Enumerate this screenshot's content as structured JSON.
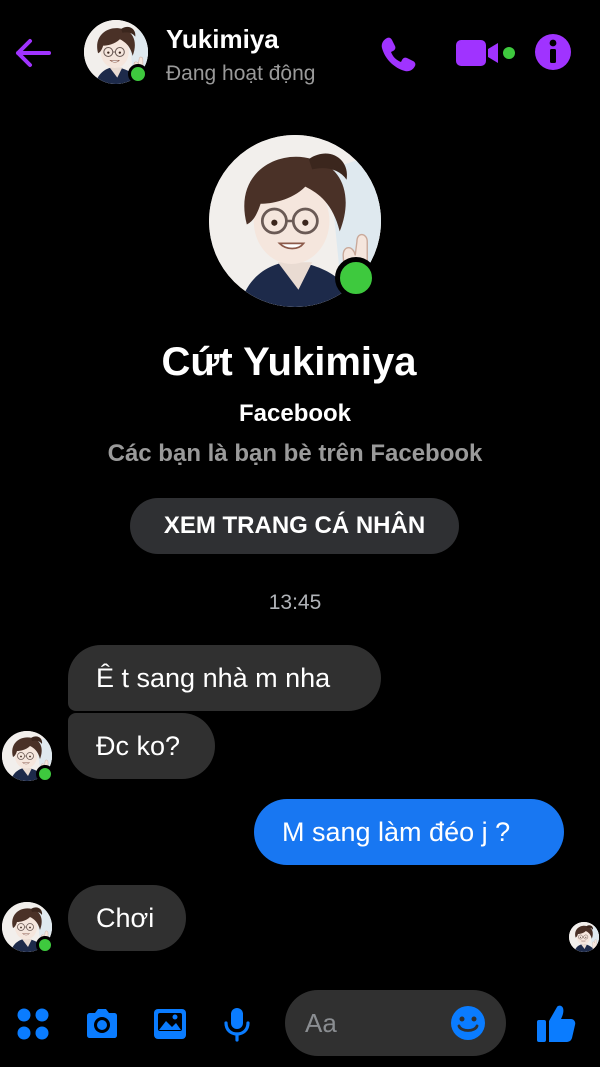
{
  "colors": {
    "background": "#000000",
    "accent_purple": "#a033ff",
    "accent_blue": "#0a7cff",
    "online_green": "#3ec93e",
    "incoming_bubble": "#303030",
    "outgoing_bubble": "#1877f2",
    "secondary_text": "#9a9a9a"
  },
  "header": {
    "contact_name": "Yukimiya",
    "status": "Đang hoạt động",
    "icons": [
      "back-arrow-icon",
      "phone-icon",
      "video-camera-icon",
      "info-icon"
    ]
  },
  "profile": {
    "name": "Cứt Yukimiya",
    "source": "Facebook",
    "relation": "Các bạn là bạn bè trên Facebook",
    "view_profile_label": "XEM TRANG CÁ NHÂN"
  },
  "conversation": {
    "timestamp": "13:45",
    "messages": [
      {
        "direction": "incoming",
        "text": "Ê t sang nhà m nha"
      },
      {
        "direction": "incoming",
        "text": "Đc ko?"
      },
      {
        "direction": "outgoing",
        "text": "M sang làm đéo j ?"
      },
      {
        "direction": "incoming",
        "text": "Chơi"
      }
    ]
  },
  "composer": {
    "placeholder": "Aa",
    "icons": [
      "menu-grid-icon",
      "camera-icon",
      "gallery-icon",
      "microphone-icon",
      "emoji-icon",
      "thumbs-up-icon"
    ]
  }
}
